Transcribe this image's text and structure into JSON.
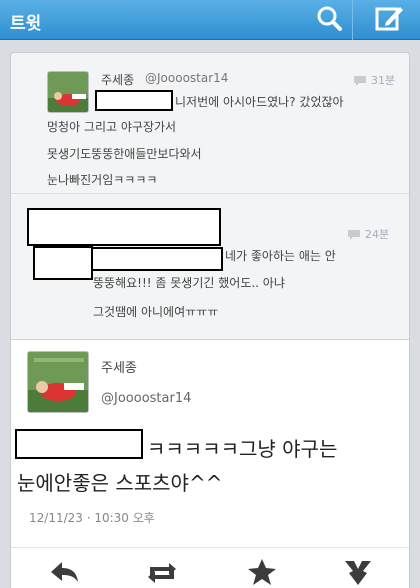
{
  "header": {
    "title": "트윗",
    "search_icon": "search-icon",
    "compose_icon": "compose-icon"
  },
  "reply1": {
    "name": "주세종",
    "handle": "@Joooostar14",
    "ago": "31분",
    "line1": "니저번에 아시아드였나? 갔었잖아",
    "line2": "멍청아 그리고 야구장가서",
    "line3": "못생기도뚱뚱한애들만보다와서",
    "line4": "눈나빠진거임ㅋㅋㅋㅋ"
  },
  "reply2": {
    "ago": "24분",
    "line1": "네가 좋아하는 애는 안",
    "line2": "뚱뚱해요!!! 좀 못생기긴 했어도.. 아냐",
    "line3": "그것땜에 아니에여ㅠㅠㅠ"
  },
  "tweet": {
    "name": "주세종",
    "handle": "@Joooostar14",
    "line1": "ㅋㅋㅋㅋㅋ그냥 야구는",
    "line2": "눈에안좋은 스포츠야^^",
    "time": "12/11/23 · 10:30 오후"
  },
  "actions": [
    "reply-icon",
    "retweet-icon",
    "favorite-icon",
    "more-icon"
  ],
  "colors": {
    "header": "#3a9ad9",
    "card": "#ffffff",
    "background": "#d9dde1"
  }
}
